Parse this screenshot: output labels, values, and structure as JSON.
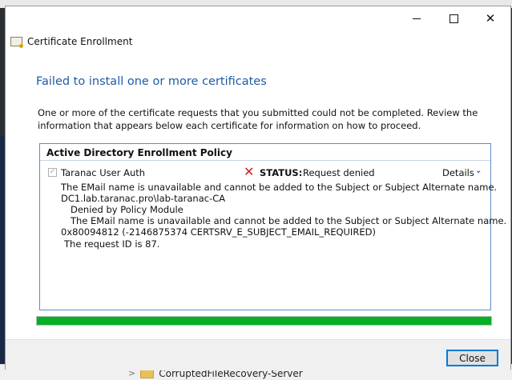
{
  "dialog": {
    "title": "Certificate Enrollment",
    "heading": "Failed to install one or more certificates",
    "description": "One or more of the certificate requests that you submitted could not be completed. Review the information that appears below each certificate for information on how to proceed.",
    "policy": {
      "title": "Active Directory Enrollment Policy",
      "certificate": {
        "name": "Taranac User Auth",
        "checked": true,
        "status_label": "STATUS:",
        "status_value": "Request denied",
        "details_label": "Details",
        "messages": [
          "The EMail name is unavailable and cannot be added to the Subject or Subject Alternate name.",
          "DC1.lab.taranac.pro\\lab-taranac-CA",
          "Denied by Policy Module",
          "The EMail name is unavailable and cannot be added to the Subject or Subject Alternate name.",
          "0x80094812 (-2146875374 CERTSRV_E_SUBJECT_EMAIL_REQUIRED)",
          "The request ID is 87."
        ]
      }
    },
    "progress": 1.0,
    "close_label": "Close"
  },
  "background": {
    "explorer_item": "CorruptedFileRecovery-Server"
  },
  "colors": {
    "heading": "#1e5ba8",
    "status_error": "#d02020",
    "progress": "#06b025",
    "accent_border": "#0078d7"
  },
  "icons": {
    "app": "certificate-icon",
    "status": "error-x-icon",
    "details": "chevron-down-icon"
  }
}
